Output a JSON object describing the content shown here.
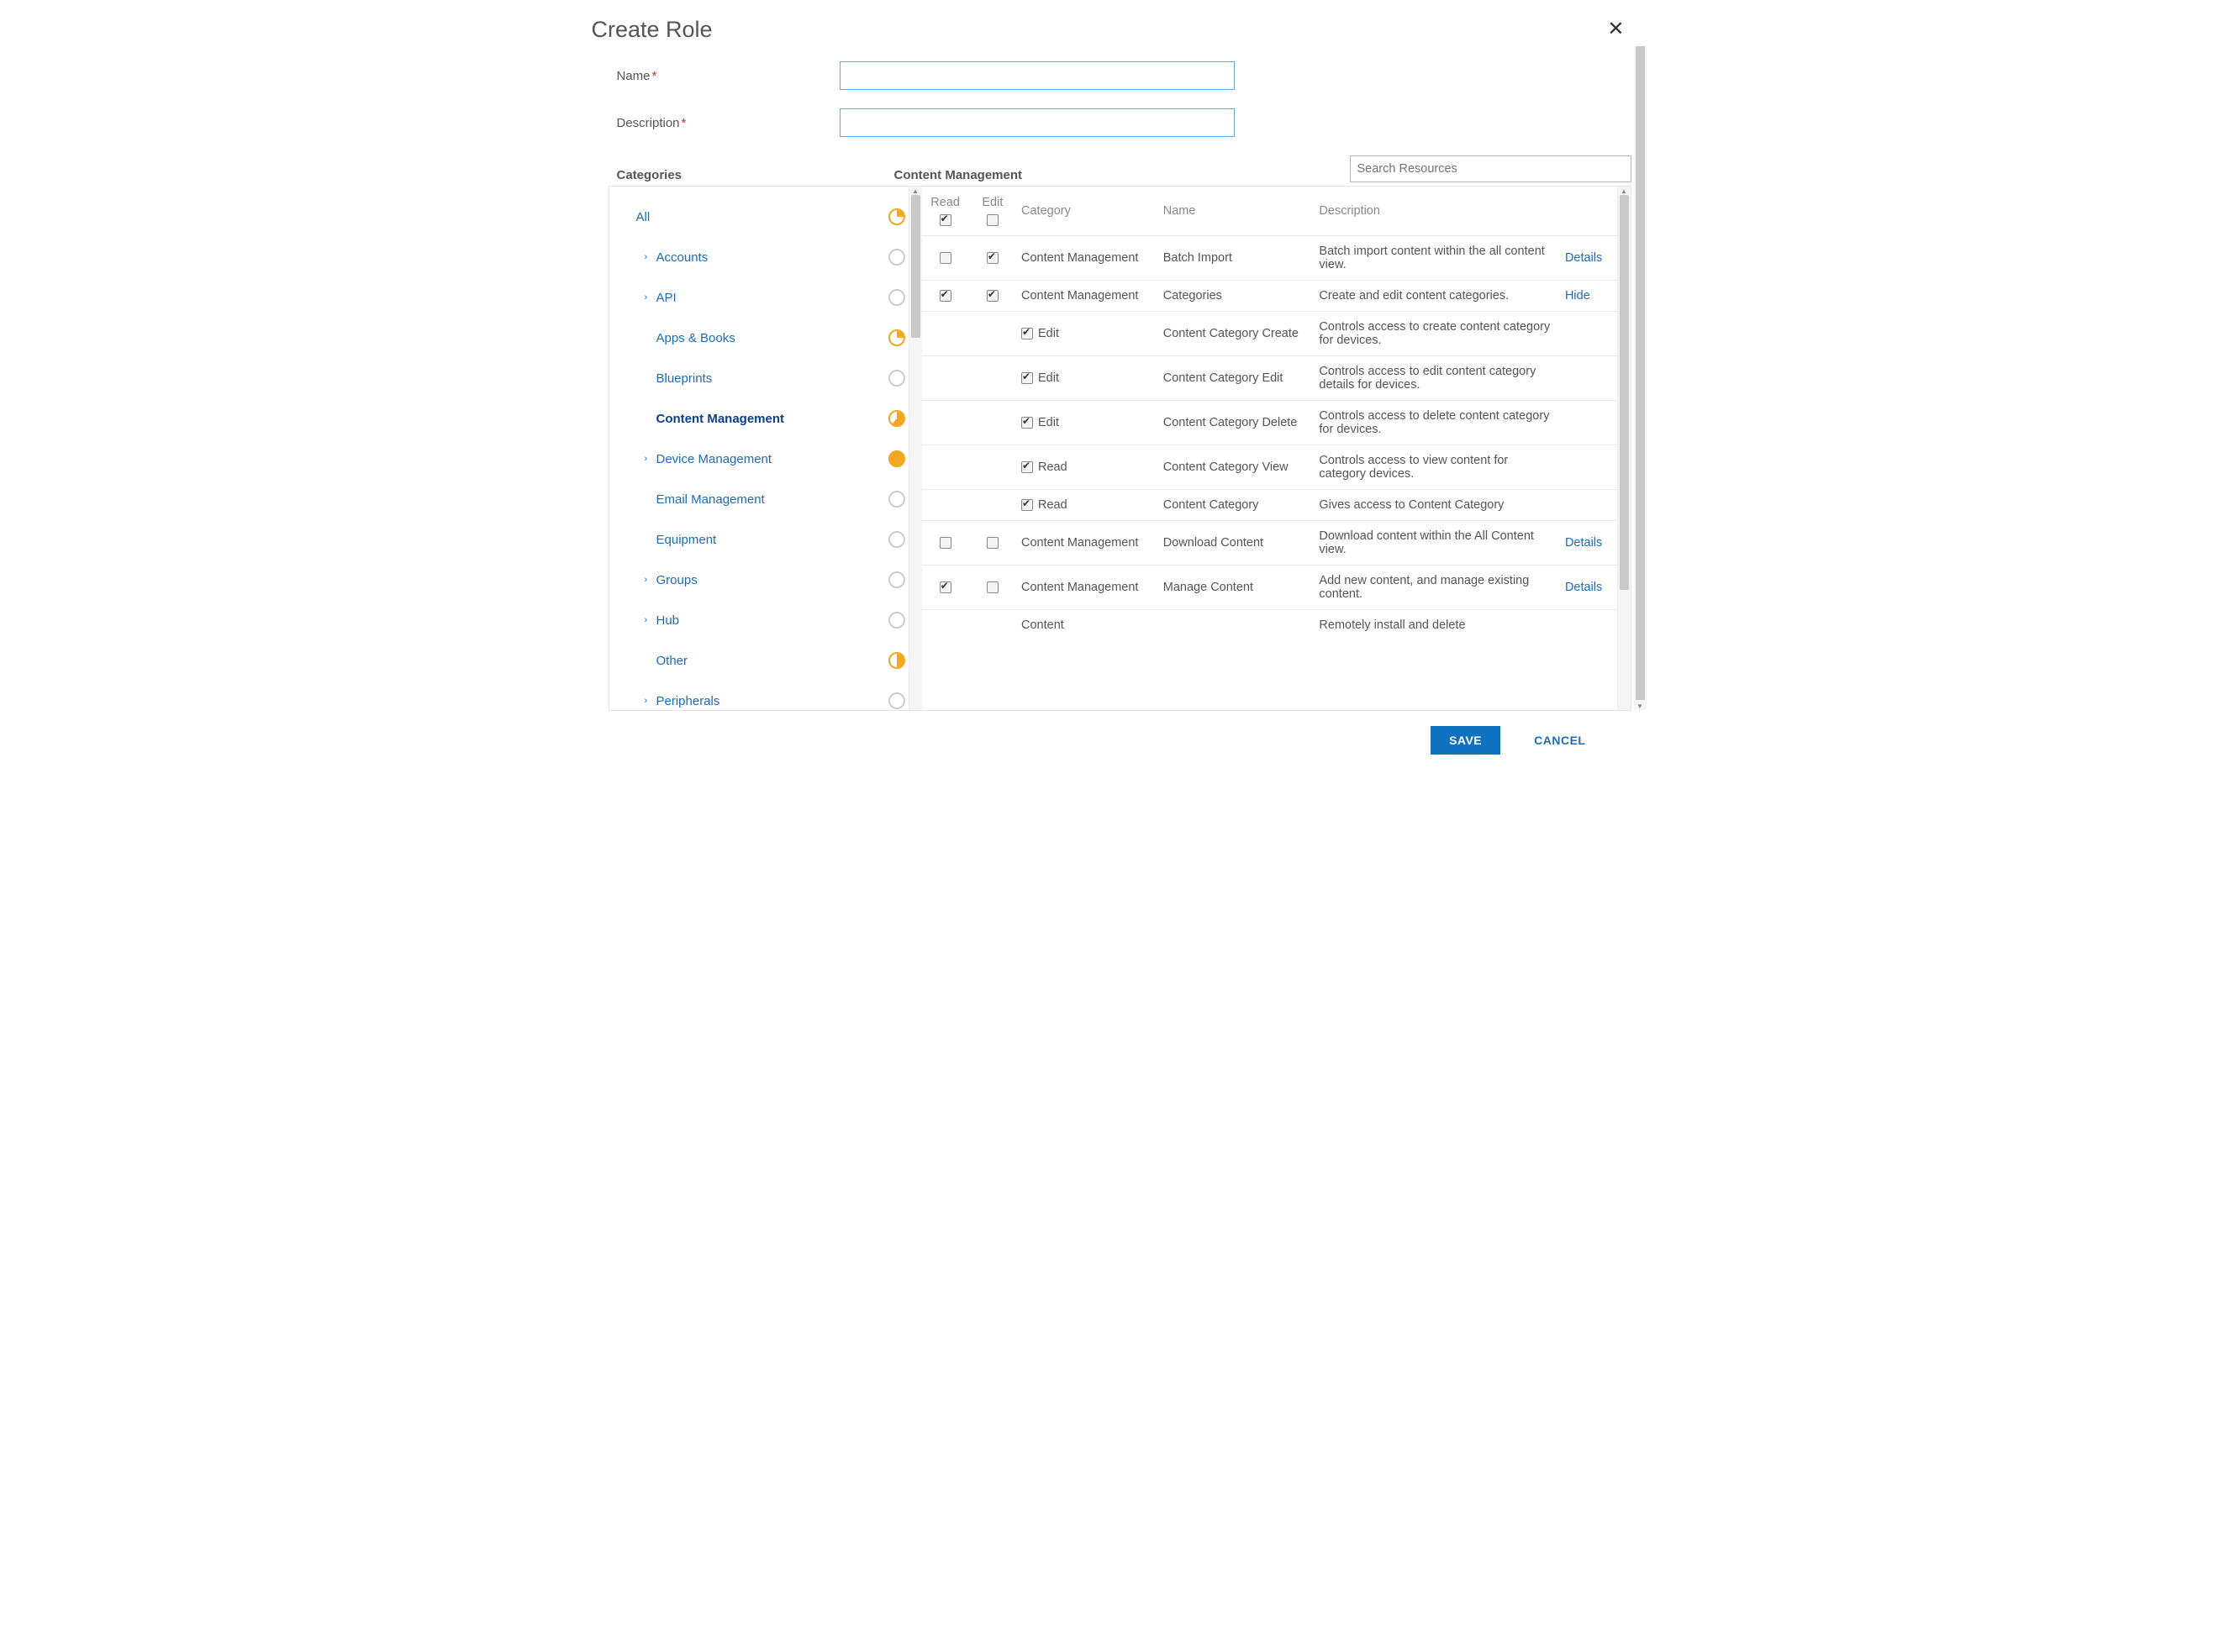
{
  "dialog": {
    "title": "Create Role",
    "name_label": "Name",
    "description_label": "Description",
    "categories_label": "Categories",
    "section_title": "Content Management",
    "search_placeholder": "Search Resources",
    "save_label": "SAVE",
    "cancel_label": "CANCEL"
  },
  "table": {
    "headers": {
      "read": "Read",
      "edit": "Edit",
      "category": "Category",
      "name": "Name",
      "description": "Description"
    },
    "head_read_checked": true,
    "head_edit_checked": false,
    "rows": [
      {
        "read": false,
        "edit": true,
        "category": "Content Management",
        "name": "Batch Import",
        "description": "Batch import content within the all content view.",
        "action": "Details"
      },
      {
        "read": true,
        "edit": true,
        "category": "Content Management",
        "name": "Categories",
        "description": "Create and edit content categories.",
        "action": "Hide"
      },
      {
        "sub": true,
        "perm_checked": true,
        "perm_label": "Edit",
        "name": "Content Category Create",
        "description": "Controls access to create content category for devices."
      },
      {
        "sub": true,
        "perm_checked": true,
        "perm_label": "Edit",
        "name": "Content Category Edit",
        "description": "Controls access to edit content category details for devices."
      },
      {
        "sub": true,
        "perm_checked": true,
        "perm_label": "Edit",
        "name": "Content Category Delete",
        "description": "Controls access to delete content category for devices."
      },
      {
        "sub": true,
        "perm_checked": true,
        "perm_label": "Read",
        "name": "Content Category View",
        "description": "Controls access to view content for category devices."
      },
      {
        "sub": true,
        "perm_checked": true,
        "perm_label": "Read",
        "name": "Content Category",
        "description": "Gives access to Content Category"
      },
      {
        "read": false,
        "edit": false,
        "category": "Content Management",
        "name": "Download Content",
        "description": "Download content within the All Content view.",
        "action": "Details"
      },
      {
        "read": true,
        "edit": false,
        "category": "Content Management",
        "name": "Manage Content",
        "description": "Add new content, and manage existing content.",
        "action": "Details"
      },
      {
        "partial": true,
        "category_partial": "Content",
        "description_partial": "Remotely install and delete"
      }
    ]
  },
  "categories": [
    {
      "label": "All",
      "indent": false,
      "chevron": false,
      "pie": "quarter-fill",
      "active": false
    },
    {
      "label": "Accounts",
      "indent": true,
      "chevron": true,
      "pie": "none",
      "active": false
    },
    {
      "label": "API",
      "indent": true,
      "chevron": true,
      "pie": "none",
      "active": false
    },
    {
      "label": "Apps & Books",
      "indent": true,
      "chevron": false,
      "pie": "quarter-fill",
      "active": false
    },
    {
      "label": "Blueprints",
      "indent": true,
      "chevron": false,
      "pie": "none",
      "active": false
    },
    {
      "label": "Content Management",
      "indent": true,
      "chevron": false,
      "pie": "big-fill",
      "active": true
    },
    {
      "label": "Device Management",
      "indent": true,
      "chevron": true,
      "pie": "full",
      "active": false
    },
    {
      "label": "Email Management",
      "indent": true,
      "chevron": false,
      "pie": "none",
      "active": false
    },
    {
      "label": "Equipment",
      "indent": true,
      "chevron": false,
      "pie": "none",
      "active": false
    },
    {
      "label": "Groups",
      "indent": true,
      "chevron": true,
      "pie": "none",
      "active": false
    },
    {
      "label": "Hub",
      "indent": true,
      "chevron": true,
      "pie": "none",
      "active": false
    },
    {
      "label": "Other",
      "indent": true,
      "chevron": false,
      "pie": "half-fill",
      "active": false
    },
    {
      "label": "Peripherals",
      "indent": true,
      "chevron": true,
      "pie": "none",
      "active": false
    }
  ]
}
